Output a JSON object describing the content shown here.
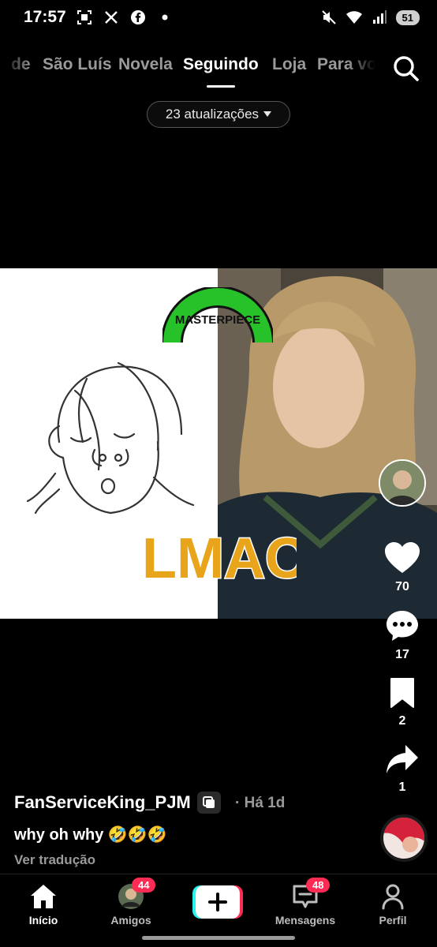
{
  "status_bar": {
    "time": "17:57",
    "battery": "51"
  },
  "tabs": [
    {
      "label": "de"
    },
    {
      "label": "São Luís"
    },
    {
      "label": "Novela"
    },
    {
      "label": "Seguindo"
    },
    {
      "label": "Loja"
    },
    {
      "label": "Para vo"
    }
  ],
  "updates_pill": {
    "label": "23 atualizações"
  },
  "video": {
    "sticker_top": "MASTERPIECE",
    "sticker_bottom": "LMAO!"
  },
  "actions": {
    "likes": "70",
    "comments": "17",
    "saves": "2",
    "shares": "1"
  },
  "caption": {
    "username": "FanServiceKing_PJM",
    "time": "· Há 1d",
    "text": "why oh why 🤣🤣🤣",
    "translate": "Ver tradução"
  },
  "bottom_nav": {
    "home": "Início",
    "friends": "Amigos",
    "friends_badge": "44",
    "messages": "Mensagens",
    "messages_badge": "48",
    "profile": "Perfil"
  },
  "colors": {
    "badge": "#fe2c55",
    "create_cyan": "#25f4ee",
    "create_red": "#fe2c55"
  }
}
